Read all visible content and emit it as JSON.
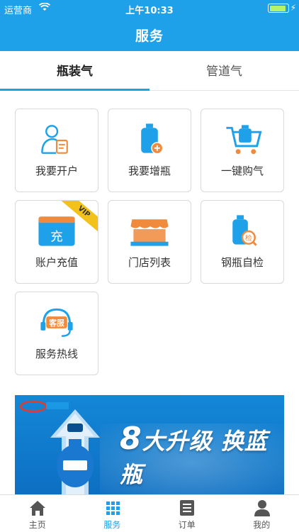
{
  "status_bar": {
    "carrier": "运营商",
    "time": "上午10:33"
  },
  "header": {
    "title": "服务"
  },
  "tabs": [
    {
      "label": "瓶装气",
      "active": true
    },
    {
      "label": "管道气",
      "active": false
    }
  ],
  "services": [
    {
      "label": "我要开户",
      "icon": "person-document-icon"
    },
    {
      "label": "我要增瓶",
      "icon": "gas-cylinder-add-icon"
    },
    {
      "label": "一键购气",
      "icon": "shopping-cart-icon"
    },
    {
      "label": "账户充值",
      "icon": "recharge-card-icon",
      "badge": "VIP",
      "icon_text": "充"
    },
    {
      "label": "门店列表",
      "icon": "storefront-icon"
    },
    {
      "label": "钢瓶自检",
      "icon": "cylinder-inspect-icon",
      "icon_text": "检"
    },
    {
      "label": "服务热线",
      "icon": "headset-icon",
      "icon_text": "客服"
    }
  ],
  "banner": {
    "slogan_num": "8",
    "slogan_text": "大升级 换蓝瓶"
  },
  "bottom_nav": [
    {
      "label": "主页",
      "icon": "home-icon",
      "active": false
    },
    {
      "label": "服务",
      "icon": "grid-icon",
      "active": true
    },
    {
      "label": "订单",
      "icon": "list-icon",
      "active": false
    },
    {
      "label": "我的",
      "icon": "user-icon",
      "active": false
    }
  ],
  "colors": {
    "primary": "#1fa1ea",
    "accent_orange": "#f08a3c",
    "vip_yellow": "#f3c21a"
  }
}
